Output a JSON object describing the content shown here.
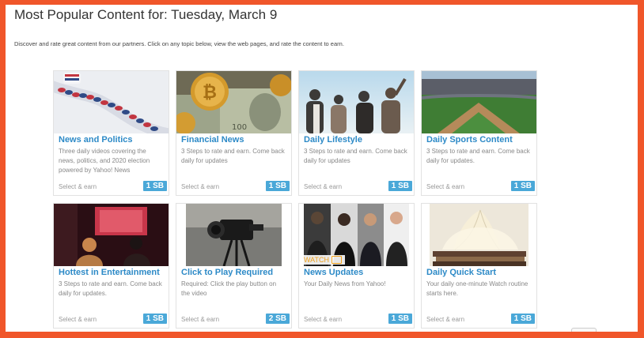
{
  "page": {
    "title": "Most Popular Content for: Tuesday, March 9",
    "description": "Discover and rate great content from our partners. Click on any topic below, view the web pages, and rate the content to earn."
  },
  "cards": [
    {
      "title": "News and Politics",
      "description": "Three daily videos covering the news, politics, and 2020 election powered by Yahoo! News",
      "footer": "Select & earn",
      "reward": "1 SB",
      "image": "news-politics-image"
    },
    {
      "title": "Financial News",
      "description": "3 Steps to rate and earn. Come back daily for updates",
      "footer": "Select & earn",
      "reward": "1 SB",
      "image": "financial-news-image"
    },
    {
      "title": "Daily Lifestyle",
      "description": "3 Steps to rate and earn. Come back daily for updates",
      "footer": "Select & earn",
      "reward": "1 SB",
      "image": "daily-lifestyle-image"
    },
    {
      "title": "Daily Sports Content",
      "description": "3 Steps to rate and earn. Come back daily for updates.",
      "footer": "Select & earn",
      "reward": "1 SB",
      "image": "daily-sports-image"
    },
    {
      "title": "Hottest in Entertainment",
      "description": "3 Steps to rate and earn. Come back daily for updates.",
      "footer": "Select & earn",
      "reward": "1 SB",
      "image": "entertainment-image"
    },
    {
      "title": "Click to Play Required",
      "description": "Required: Click the play button on the video",
      "footer": "Select & earn",
      "reward": "2 SB",
      "image": "click-to-play-image"
    },
    {
      "title": "News Updates",
      "description": "Your Daily News from Yahoo!",
      "footer": "Select & earn",
      "reward": "1 SB",
      "image": "news-updates-image",
      "overlay": "WATCH"
    },
    {
      "title": "Daily Quick Start",
      "description": "Your daily one-minute Watch routine starts here.",
      "footer": "Select & earn",
      "reward": "1 SB",
      "image": "daily-quick-start-image"
    }
  ],
  "colors": {
    "frame": "#f0562a",
    "title_link": "#2d8ac7",
    "badge": "#4aa8d8",
    "watch": "#f0a11c"
  }
}
